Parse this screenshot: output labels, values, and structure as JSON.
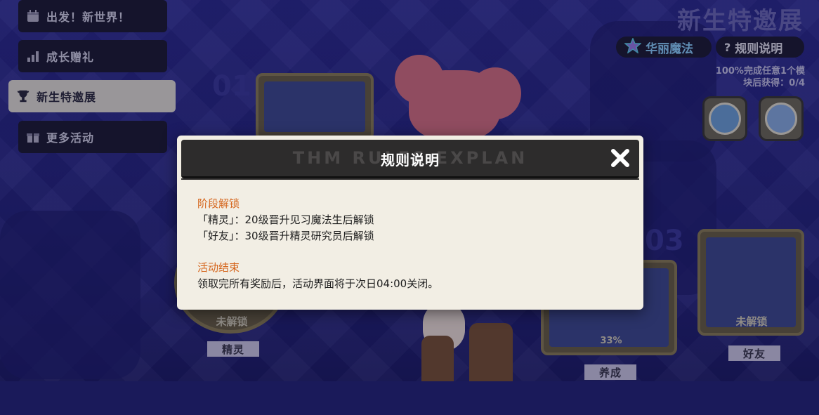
{
  "sidebar": {
    "items": [
      {
        "label": "出发！新世界！",
        "icon": "calendar-icon"
      },
      {
        "label": "成长赠礼",
        "icon": "growth-chart-icon"
      },
      {
        "label": "新生特邀展",
        "icon": "trophy-icon",
        "active": true
      },
      {
        "label": "更多活动",
        "icon": "gift-icon"
      }
    ]
  },
  "header": {
    "title": "新生特邀展",
    "magic_button": "华丽魔法",
    "rules_button": "规则说明",
    "progress_line1": "100%完成任意1个模",
    "progress_line2": "块后获得：0/4"
  },
  "stages": {
    "stage1": {
      "number": "01",
      "lock": "未解锁",
      "tag": "精灵"
    },
    "stage2": {
      "progress": "33%",
      "tag": "养成"
    },
    "stage3": {
      "number": "03",
      "lock": "未解锁",
      "tag": "好友"
    }
  },
  "modal": {
    "title": "规则说明",
    "decor_text": "THM RULES EXPLAN",
    "section1_heading": "阶段解锁",
    "section1_line1": "「精灵」：20级晋升见习魔法生后解锁",
    "section1_line2": "「好友」：30级晋升精灵研究员后解锁",
    "section2_heading": "活动结束",
    "section2_line1": "领取完所有奖励后，活动界面将于次日04:00关闭。"
  },
  "colors": {
    "accent_orange": "#d5651c",
    "modal_bg": "#f2eee4",
    "header_dark": "#2d2c2c",
    "background_blue": "#2b2a8c"
  }
}
